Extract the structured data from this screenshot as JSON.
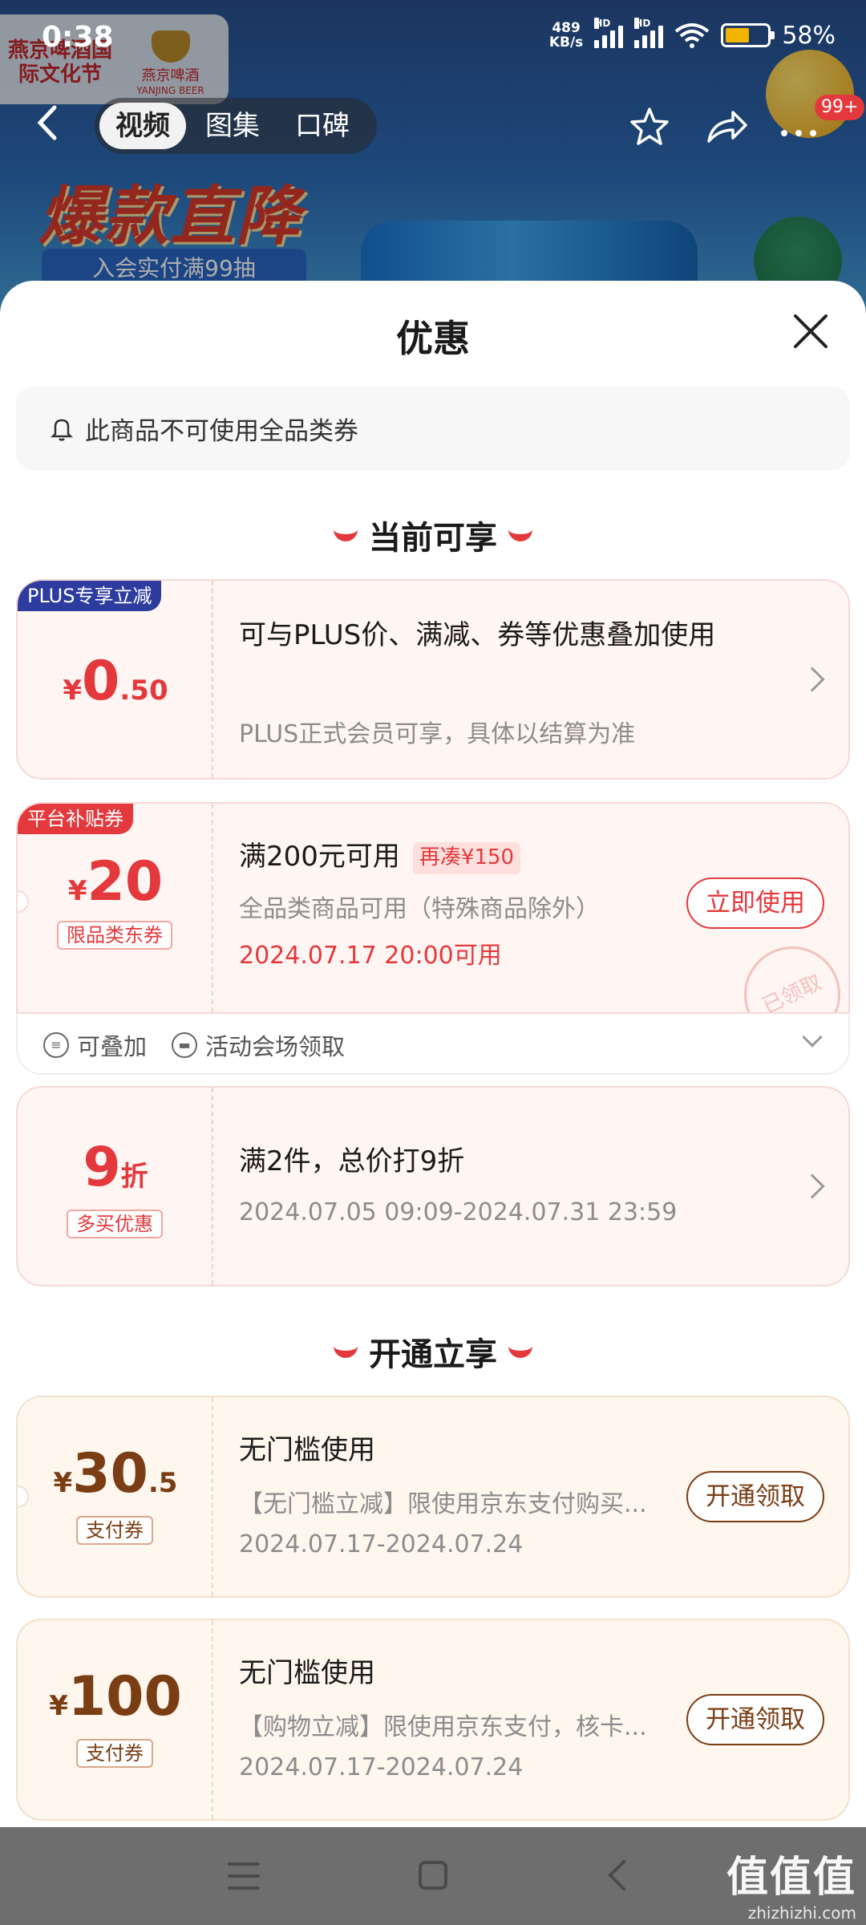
{
  "status_bar": {
    "time": "0:38",
    "net_speed_value": "489",
    "net_speed_unit": "KB/s",
    "hd1": "HD",
    "hd2": "HD",
    "battery_pct": "58%",
    "battery_level": 0.58
  },
  "background": {
    "logo_left": "燕京啤酒国际文化节",
    "logo_right_cn": "燕京啤酒",
    "logo_right_en": "YANJING BEER",
    "slogan": "爆款直降",
    "join_text": "入会实付满99抽"
  },
  "top_nav": {
    "tabs": [
      {
        "label": "视频",
        "active": true
      },
      {
        "label": "图集",
        "active": false
      },
      {
        "label": "口碑",
        "active": false
      }
    ],
    "badge": "99+"
  },
  "sheet": {
    "title": "优惠",
    "notice": "此商品不可使用全品类券",
    "section_current": "当前可享",
    "section_open": "开通立享"
  },
  "offers": [
    {
      "corner_tag": "PLUS专享立减",
      "currency": "¥",
      "amount_main": "0",
      "amount_decimal": ".50",
      "title": "可与PLUS价、满减、券等优惠叠加使用",
      "desc": "PLUS正式会员可享，具体以结算为准"
    },
    {
      "corner_tag": "平台补贴券",
      "currency": "¥",
      "amount_main": "20",
      "sub_tag": "限品类东券",
      "title": "满200元可用",
      "extra_tag": "再凑¥150",
      "desc": "全品类商品可用（特殊商品除外）",
      "time": "2024.07.17 20:00可用",
      "button": "立即使用",
      "stamp": "已领取",
      "footer_stack": "可叠加",
      "footer_source": "活动会场领取"
    },
    {
      "amount_main": "9",
      "amount_unit": "折",
      "sub_tag": "多买优惠",
      "title": "满2件，总价打9折",
      "desc": "2024.07.05 09:09-2024.07.31 23:59"
    },
    {
      "currency": "¥",
      "amount_main": "30",
      "amount_decimal": ".5",
      "sub_tag": "支付券",
      "title": "无门槛使用",
      "desc": "【无门槛立减】限使用京东支付购买...",
      "time": "2024.07.17-2024.07.24",
      "button": "开通领取"
    },
    {
      "currency": "¥",
      "amount_main": "100",
      "sub_tag": "支付券",
      "title": "无门槛使用",
      "desc": "【购物立减】限使用京东支付，核卡...",
      "time": "2024.07.17-2024.07.24",
      "button": "开通领取"
    }
  ],
  "watermark": {
    "main": "值值值",
    "sub": "zhizhizhi.com"
  },
  "colors": {
    "accent_red": "#e4393c",
    "plus_blue": "#2d3c9e",
    "subsidy_red": "#e4393c",
    "brown": "#7a3d14"
  }
}
